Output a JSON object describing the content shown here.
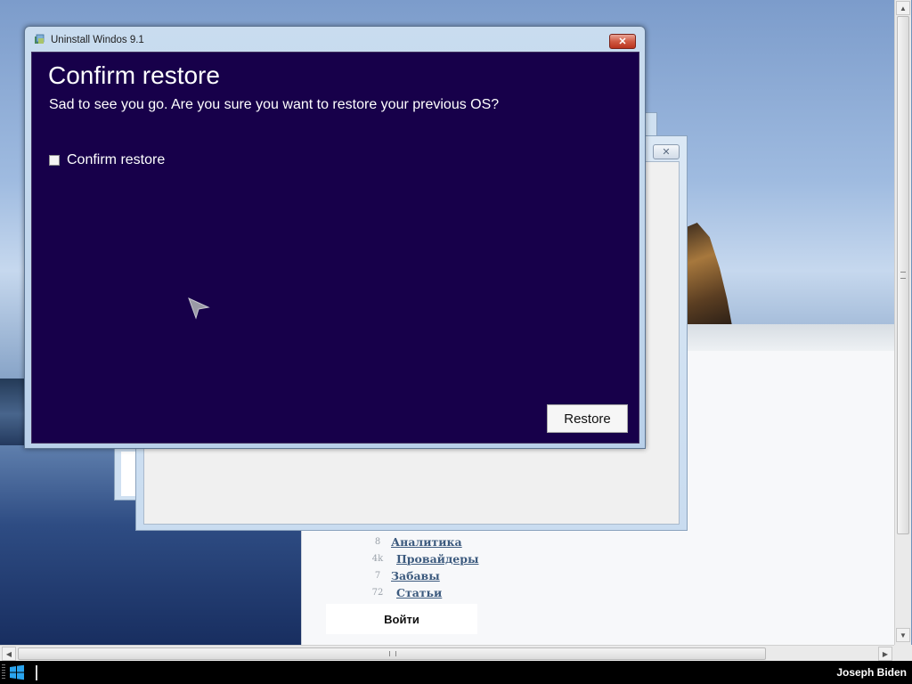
{
  "dialog": {
    "title": "Uninstall Windos 9.1",
    "close_label": "✕",
    "heading": "Confirm restore",
    "subtitle": "Sad to see you go. Are you sure you want to restore your previous OS?",
    "checkbox_label": "Confirm restore",
    "checkbox_checked": false,
    "restore_label": "Restore"
  },
  "background_window": {
    "close_label": "✕"
  },
  "web_page": {
    "menu": [
      {
        "count": "8",
        "label": "Аналитика"
      },
      {
        "count": "4k",
        "label": "Провайдеры"
      },
      {
        "count": "7",
        "label": "Забавы"
      },
      {
        "count": "72",
        "label": "Статьи"
      }
    ],
    "login_label": "Войти"
  },
  "taskbar": {
    "user_name": "Joseph Biden"
  },
  "icons": {
    "dialog": "app-icon",
    "cursor": "cursor-arrow-icon",
    "start": "windows-logo-icon"
  },
  "colors": {
    "dialog_background": "#17004a",
    "titlebar": "#c9dcef",
    "close_button": "#d05a43",
    "taskbar": "#000000"
  }
}
